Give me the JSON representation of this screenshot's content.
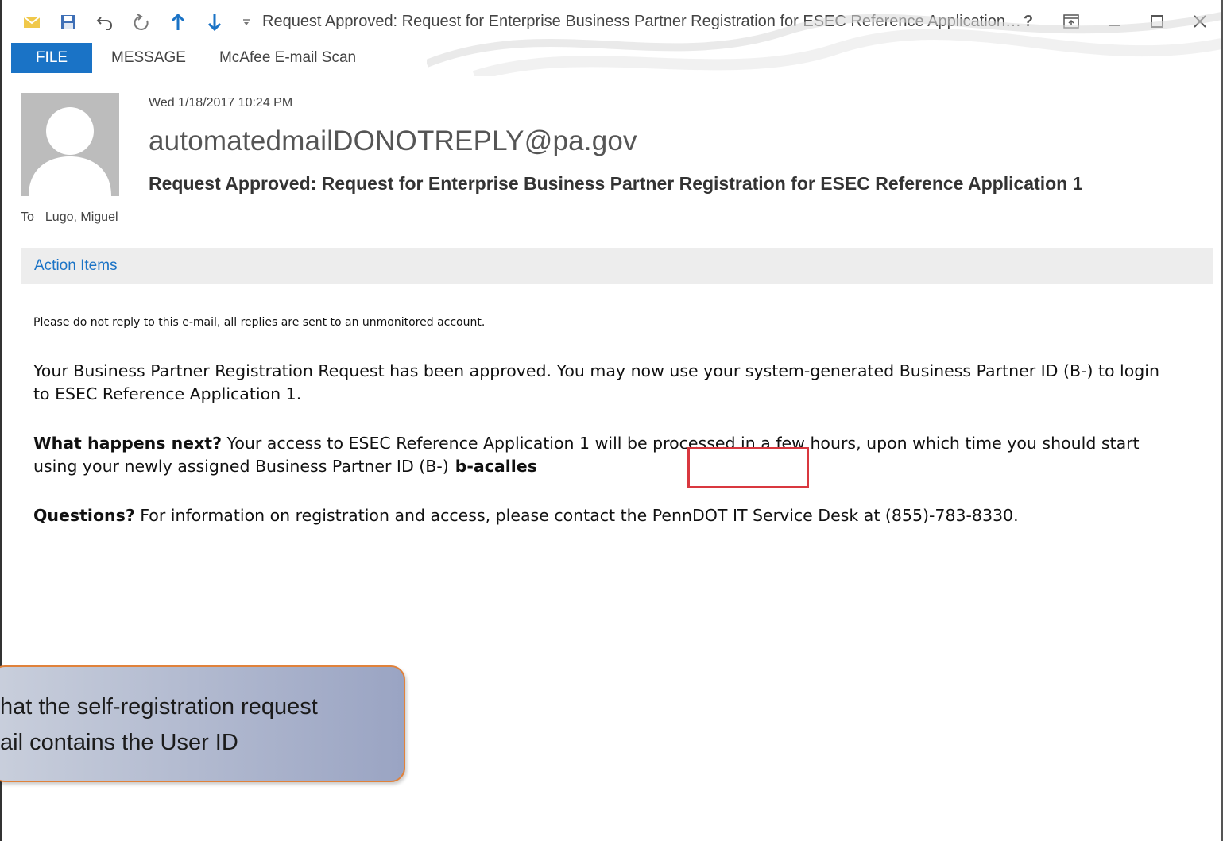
{
  "window": {
    "title": "Request Approved: Request for Enterprise Business Partner Registration for ESEC Reference Application…",
    "controls": [
      "help-icon",
      "restore-ribbon-icon",
      "minimize-icon",
      "maximize-icon",
      "close-icon"
    ]
  },
  "quick_access": [
    "mail-icon",
    "save-icon",
    "undo-icon",
    "redo-icon",
    "up-arrow-icon",
    "down-arrow-icon",
    "customize-icon"
  ],
  "tabs": [
    {
      "label": "FILE"
    },
    {
      "label": "MESSAGE"
    },
    {
      "label": "McAfee E-mail Scan"
    }
  ],
  "message": {
    "date": "Wed 1/18/2017 10:24 PM",
    "sender": "automatedmailDONOTREPLY@pa.gov",
    "subject": "Request Approved: Request for Enterprise Business Partner Registration for ESEC Reference Application 1",
    "to_label": "To",
    "to": "Lugo, Miguel",
    "action_items": "Action Items"
  },
  "body": {
    "notice": "Please do not reply to this e-mail, all replies are sent to an unmonitored account.",
    "approved": "Your Business Partner Registration Request has been approved. You may now use your system-generated Business Partner ID (B-) to login to ESEC Reference Application 1.",
    "next_heading": "What happens next?",
    "next_text": " Your access to ESEC Reference Application 1 will be processed in a few hours, upon which time you should start using your newly assigned Business Partner ID (B-)",
    "user_id": "b-acalles",
    "questions_heading": "Questions?",
    "questions_text": " For information on registration and access, please contact the PennDOT IT Service Desk at (855)-783-8330."
  },
  "callout": {
    "line1": "hat the self-registration request",
    "line2": "ail contains the User ID"
  },
  "colors": {
    "accent": "#1a73c6",
    "highlight_box": "#d9383f",
    "callout_border": "#e0823b"
  }
}
